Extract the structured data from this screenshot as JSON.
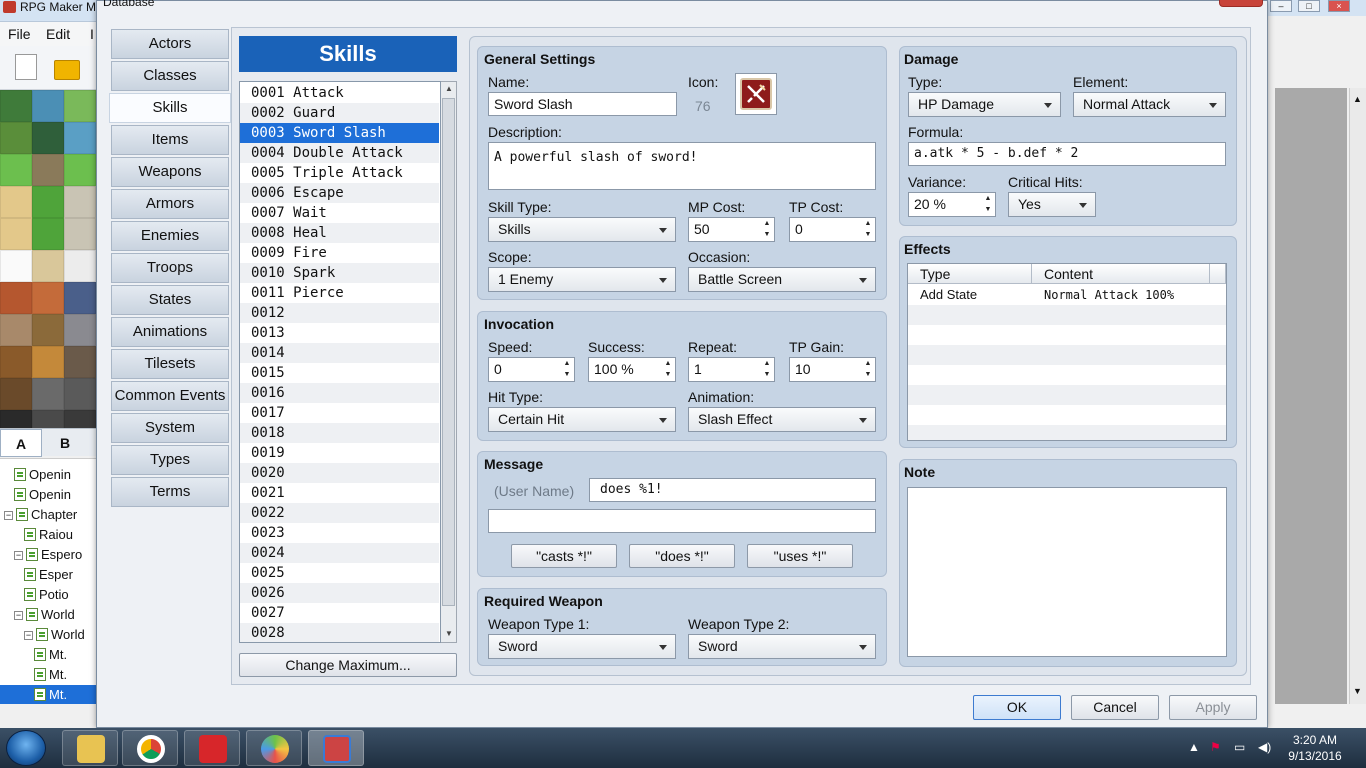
{
  "app": {
    "title": "RPG Maker M",
    "menu": [
      "File",
      "Edit",
      "I"
    ]
  },
  "tileset_tabs": [
    "A",
    "B"
  ],
  "tree_items": [
    {
      "label": "Openin",
      "level": 2,
      "toggle": ""
    },
    {
      "label": "Openin",
      "level": 2,
      "toggle": ""
    },
    {
      "label": "Chapter",
      "level": 1,
      "toggle": "−"
    },
    {
      "label": "Raiou",
      "level": 3,
      "toggle": ""
    },
    {
      "label": "Espero",
      "level": 2,
      "toggle": "−"
    },
    {
      "label": "Esper",
      "level": 3,
      "toggle": ""
    },
    {
      "label": "Potio",
      "level": 3,
      "toggle": ""
    },
    {
      "label": "World",
      "level": 2,
      "toggle": "−"
    },
    {
      "label": "World",
      "level": 3,
      "toggle": "−"
    },
    {
      "label": "Mt.",
      "level": 4,
      "toggle": ""
    },
    {
      "label": "Mt.",
      "level": 4,
      "toggle": ""
    },
    {
      "label": "Mt.",
      "level": 4,
      "toggle": "",
      "selected": true
    }
  ],
  "dialog": {
    "title": "Database",
    "tabs": [
      "Actors",
      "Classes",
      "Skills",
      "Items",
      "Weapons",
      "Armors",
      "Enemies",
      "Troops",
      "States",
      "Animations",
      "Tilesets",
      "Common Events",
      "System",
      "Types",
      "Terms"
    ],
    "selected_tab": "Skills"
  },
  "skills": {
    "header": "Skills",
    "items": [
      "0001 Attack",
      "0002 Guard",
      "0003 Sword Slash",
      "0004 Double Attack",
      "0005 Triple Attack",
      "0006 Escape",
      "0007 Wait",
      "0008 Heal",
      "0009 Fire",
      "0010 Spark",
      "0011 Pierce",
      "0012",
      "0013",
      "0014",
      "0015",
      "0016",
      "0017",
      "0018",
      "0019",
      "0020",
      "0021",
      "0022",
      "0023",
      "0024",
      "0025",
      "0026",
      "0027",
      "0028"
    ],
    "selected_index": 2,
    "change_max_label": "Change Maximum..."
  },
  "general": {
    "title": "General Settings",
    "name_label": "Name:",
    "name_value": "Sword Slash",
    "icon_label": "Icon:",
    "icon_index": "76",
    "description_label": "Description:",
    "description_value": "A powerful slash of sword!",
    "skill_type_label": "Skill Type:",
    "skill_type_value": "Skills",
    "mp_cost_label": "MP Cost:",
    "mp_cost_value": "50",
    "tp_cost_label": "TP Cost:",
    "tp_cost_value": "0",
    "scope_label": "Scope:",
    "scope_value": "1 Enemy",
    "occasion_label": "Occasion:",
    "occasion_value": "Battle Screen"
  },
  "invocation": {
    "title": "Invocation",
    "speed_label": "Speed:",
    "speed_value": "0",
    "success_label": "Success:",
    "success_value": "100 %",
    "repeat_label": "Repeat:",
    "repeat_value": "1",
    "tp_gain_label": "TP Gain:",
    "tp_gain_value": "10",
    "hit_type_label": "Hit Type:",
    "hit_type_value": "Certain Hit",
    "animation_label": "Animation:",
    "animation_value": "Slash Effect"
  },
  "message": {
    "title": "Message",
    "user_name": "(User Name)",
    "line1": "does %1!",
    "line2": "",
    "buttons": [
      "\"casts *!\"",
      "\"does *!\"",
      "\"uses *!\""
    ]
  },
  "required_weapon": {
    "title": "Required Weapon",
    "type1_label": "Weapon Type 1:",
    "type1_value": "Sword",
    "type2_label": "Weapon Type 2:",
    "type2_value": "Sword"
  },
  "damage": {
    "title": "Damage",
    "type_label": "Type:",
    "type_value": "HP Damage",
    "element_label": "Element:",
    "element_value": "Normal Attack",
    "formula_label": "Formula:",
    "formula_value": "a.atk * 5 - b.def * 2",
    "variance_label": "Variance:",
    "variance_value": "20 %",
    "critical_label": "Critical Hits:",
    "critical_value": "Yes"
  },
  "effects": {
    "title": "Effects",
    "columns": [
      "Type",
      "Content"
    ],
    "rows": [
      {
        "type": "Add State",
        "content": "Normal Attack 100%"
      }
    ]
  },
  "note": {
    "title": "Note",
    "value": ""
  },
  "footer": {
    "ok": "OK",
    "cancel": "Cancel",
    "apply": "Apply"
  },
  "taskbar": {
    "time": "3:20 AM",
    "date": "9/13/2016"
  },
  "colors": {
    "accent": "#1a62b8",
    "selection": "#1e6fd8",
    "group_bg": "#c6d4e4"
  }
}
